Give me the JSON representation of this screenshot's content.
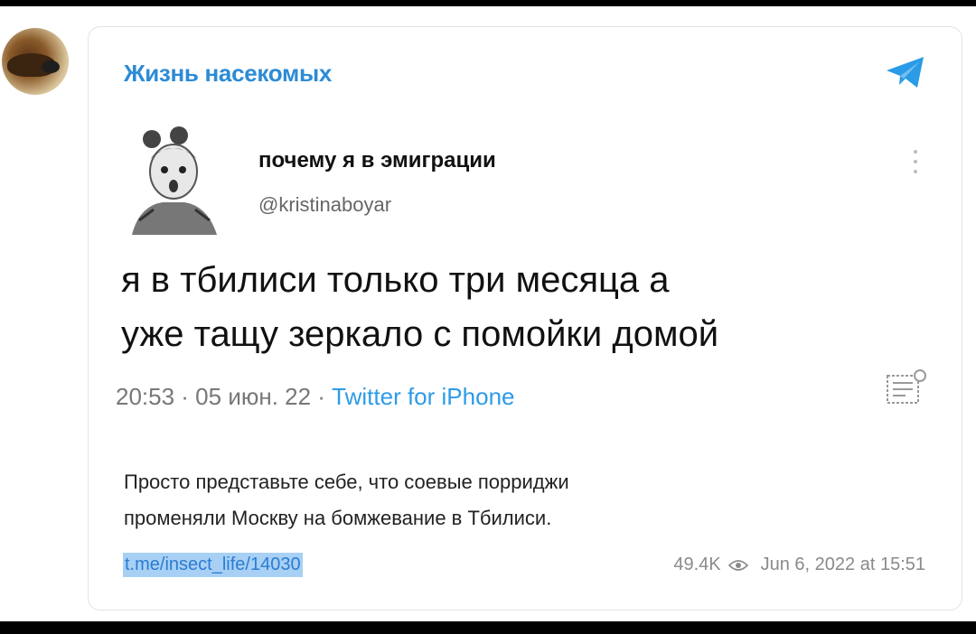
{
  "channel": {
    "name": "Жизнь насекомых",
    "icon": "telegram-icon"
  },
  "tweet": {
    "author_name": "почему я в эмиграции",
    "author_handle": "@kristinaboyar",
    "text_line1": "я в тбилиси только три месяца а",
    "text_line2": "уже тащу зеркало с помойки домой",
    "meta": "20:53 · 05 июн. 22 · ",
    "source": "Twitter for iPhone"
  },
  "post": {
    "caption_line1": "Просто представьте себе, что соевые порриджи",
    "caption_line2": "променяли Москву на бомжевание в Тбилиси.",
    "link": "t.me/insect_life/14030",
    "views": "49.4K",
    "date": "Jun 6, 2022 at 15:51"
  },
  "colors": {
    "accent": "#2c8bd6",
    "link_highlight": "#a8d0f4"
  }
}
